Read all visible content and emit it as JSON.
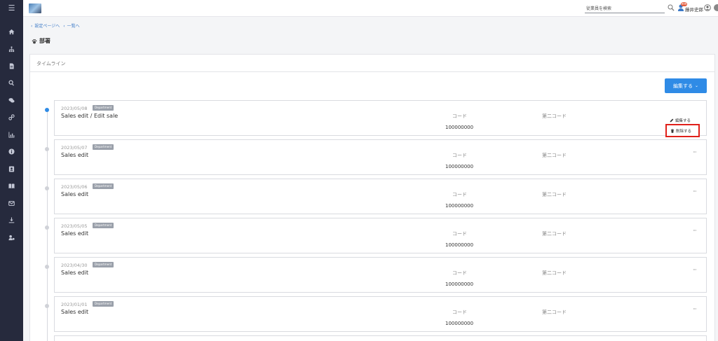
{
  "sidebar": {
    "items": [
      {
        "icon": "menu-icon"
      },
      {
        "icon": "home-icon"
      },
      {
        "icon": "org-chart-icon"
      },
      {
        "icon": "document-icon"
      },
      {
        "icon": "search-icon"
      },
      {
        "icon": "chat-icon"
      },
      {
        "icon": "link-icon"
      },
      {
        "icon": "bar-chart-icon"
      },
      {
        "icon": "info-icon"
      },
      {
        "icon": "contact-card-icon"
      },
      {
        "icon": "book-icon"
      },
      {
        "icon": "mail-icon"
      },
      {
        "icon": "download-icon"
      },
      {
        "icon": "user-settings-icon"
      }
    ]
  },
  "header": {
    "search_placeholder": "従業員を検索",
    "notification_badge": "999",
    "user_name": "藤井史郎"
  },
  "breadcrumb": {
    "items": [
      "設定ページへ",
      "一覧へ"
    ]
  },
  "page": {
    "title": "部署"
  },
  "timeline": {
    "card_title": "タイムライン",
    "edit_button_label": "編集する",
    "entries": [
      {
        "date": "2023/05/08",
        "badge": "Department",
        "title": "Sales edit / Edit sale",
        "code_label": "コード",
        "code_value": "100000000",
        "code2_label": "第二コード",
        "active": true
      },
      {
        "date": "2023/05/07",
        "badge": "Department",
        "title": "Sales edit",
        "code_label": "コード",
        "code_value": "100000000",
        "code2_label": "第二コード",
        "active": false
      },
      {
        "date": "2023/05/06",
        "badge": "Department",
        "title": "Sales edit",
        "code_label": "コード",
        "code_value": "100000000",
        "code2_label": "第二コード",
        "active": false
      },
      {
        "date": "2023/05/05",
        "badge": "Department",
        "title": "Sales edit",
        "code_label": "コード",
        "code_value": "100000000",
        "code2_label": "第二コード",
        "active": false
      },
      {
        "date": "2023/04/30",
        "badge": "Department",
        "title": "Sales edit",
        "code_label": "コード",
        "code_value": "100000000",
        "code2_label": "第二コード",
        "active": false
      },
      {
        "date": "2023/01/01",
        "badge": "Department",
        "title": "Sales edit",
        "code_label": "コード",
        "code_value": "100000000",
        "code2_label": "第二コード",
        "active": false
      }
    ],
    "more_label": "···"
  },
  "context_menu": {
    "edit_label": "編集する",
    "delete_label": "削除する"
  },
  "colors": {
    "sidebar_bg": "#262a3d",
    "accent": "#2f8be6",
    "highlight_border": "#e0201a"
  }
}
